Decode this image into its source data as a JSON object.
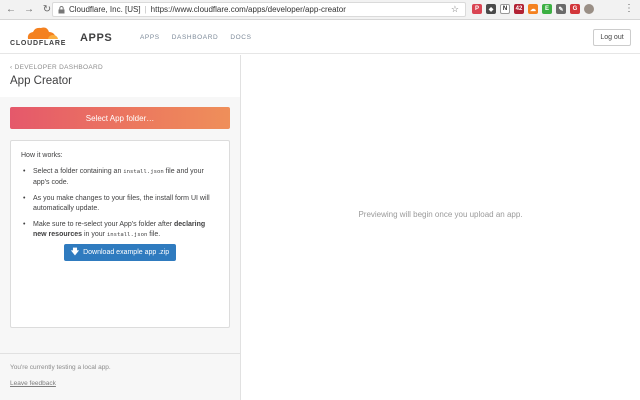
{
  "browser": {
    "site_identity": "Cloudflare, Inc. [US]",
    "url": "https://www.cloudflare.com/apps/developer/app-creator",
    "extensions": [
      {
        "name": "pocket-ext-icon",
        "color": "#d94452",
        "glyph": "P"
      },
      {
        "name": "shield-ext-icon",
        "color": "#4a4a4a",
        "glyph": "◆"
      },
      {
        "name": "notion-ext-icon",
        "color": "#ffffff",
        "glyph": "N"
      },
      {
        "name": "lastpass-ext-icon",
        "color": "#b22234",
        "glyph": "42"
      },
      {
        "name": "cloudflare-ext-icon",
        "color": "#f48120",
        "glyph": "☁"
      },
      {
        "name": "evernote-ext-icon",
        "color": "#3cb043",
        "glyph": "E"
      },
      {
        "name": "feather-ext-icon",
        "color": "#6a6a6a",
        "glyph": "✎"
      },
      {
        "name": "grammarly-ext-icon",
        "color": "#d2363a",
        "glyph": "G"
      }
    ]
  },
  "header": {
    "logo_text": "CLOUDFLARE",
    "app_name": "APPS",
    "nav": [
      "APPS",
      "DASHBOARD",
      "DOCS"
    ],
    "logout_label": "Log out",
    "brand_color": "#f48120"
  },
  "sidebar": {
    "breadcrumb": "‹ DEVELOPER DASHBOARD",
    "title": "App Creator",
    "select_button": "Select App folder…",
    "info": {
      "heading": "How it works:",
      "item1_pre": "Select a folder containing an ",
      "item1_code": "install.json",
      "item1_post": " file and your app's code.",
      "item2": "As you make changes to your files, the install form UI will automatically update.",
      "item3_pre": "Make sure to re-select your App's folder after ",
      "item3_bold": "declaring new resources",
      "item3_mid": " in your ",
      "item3_code": "install.json",
      "item3_post": " file.",
      "download_button": "Download example app .zip"
    },
    "footer_text": "You're currently testing a local app.",
    "feedback_link": "Leave feedback"
  },
  "preview": {
    "message": "Previewing will begin once you upload an app."
  }
}
